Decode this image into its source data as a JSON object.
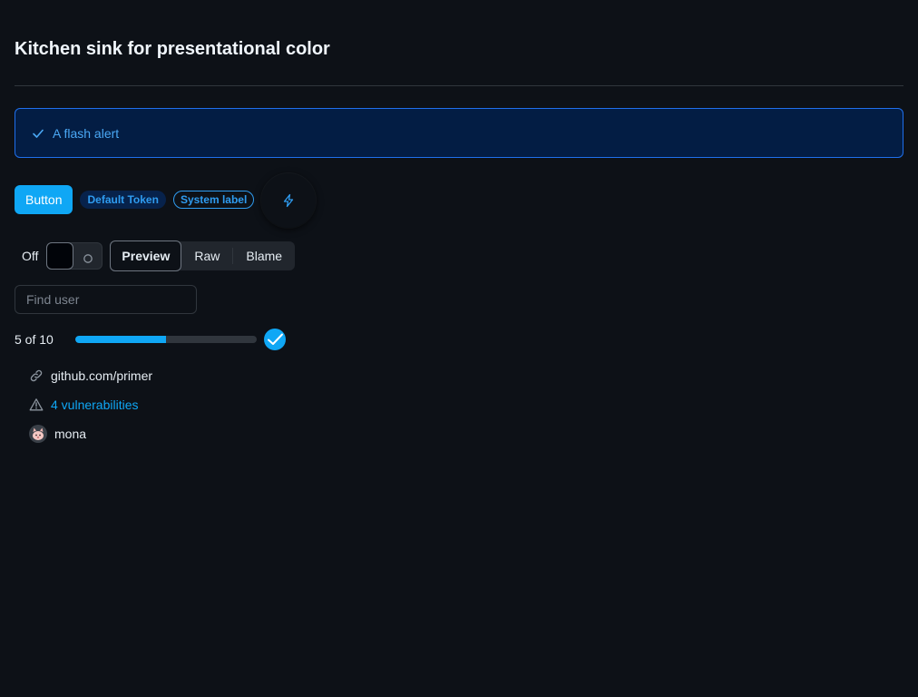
{
  "page": {
    "title": "Kitchen sink for presentational color"
  },
  "flash": {
    "icon": "check-icon",
    "text": "A flash alert"
  },
  "actions": {
    "button_label": "Button",
    "token_label": "Default Token",
    "system_label": "System label",
    "icon_button_icon": "zap-icon"
  },
  "toggle": {
    "label": "Off",
    "state": "off"
  },
  "segmented": {
    "items": [
      {
        "label": "Preview",
        "selected": true
      },
      {
        "label": "Raw",
        "selected": false
      },
      {
        "label": "Blame",
        "selected": false
      }
    ]
  },
  "search": {
    "placeholder": "Find user",
    "value": ""
  },
  "progress": {
    "label": "5 of 10",
    "fraction": 0.5,
    "complete_icon": "check-circle-icon"
  },
  "list": {
    "items": [
      {
        "icon": "link-icon",
        "text": "github.com/primer"
      },
      {
        "icon": "alert-icon",
        "text": "4 vulnerabilities"
      },
      {
        "icon": "avatar",
        "text": "mona"
      }
    ]
  },
  "colors": {
    "background": "#0d1117",
    "accent": "#0fa7f5",
    "accent_muted": "#031d44",
    "border": "#30363d",
    "fg": "#e6edf3"
  }
}
